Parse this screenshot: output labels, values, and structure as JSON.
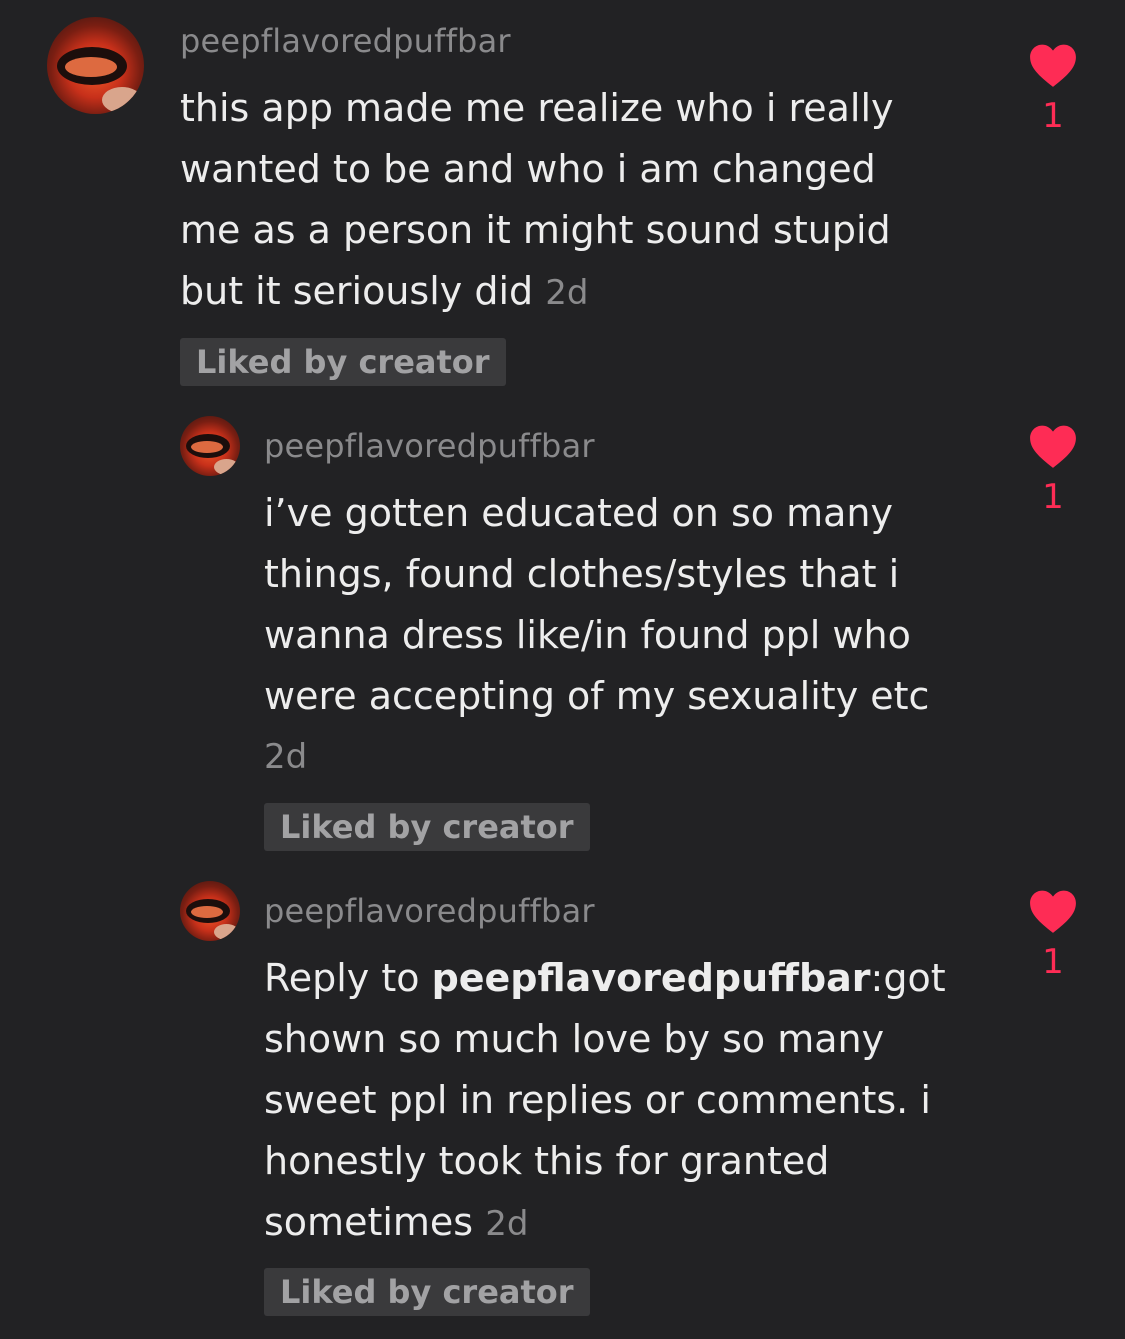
{
  "comments": [
    {
      "username": "peepflavoredpuffbar",
      "lines": [
        "this app made me realize who i really",
        "wanted to be and who i am changed",
        "me as a person it might sound stupid",
        "but it seriously did"
      ],
      "time": "2d",
      "liked_tag": "Liked by creator",
      "likes": "1"
    },
    {
      "username": "peepflavoredpuffbar",
      "lines": [
        "i’ve gotten educated on so many",
        "things, found clothes/styles that i",
        "wanna dress like/in found ppl who",
        "were accepting of my sexuality etc"
      ],
      "time": "2d",
      "liked_tag": "Liked by creator",
      "likes": "1"
    },
    {
      "username": "peepflavoredpuffbar",
      "reply_prefix": "Reply to ",
      "reply_to": "peepflavoredpuffbar",
      "reply_colon_text": ":got",
      "lines": [
        "shown so much love by so many",
        "sweet ppl in replies or comments. i",
        "honestly took this for granted",
        "sometimes"
      ],
      "time": "2d",
      "liked_tag": "Liked by creator",
      "likes": "1"
    }
  ],
  "colors": {
    "background": "#222224",
    "text": "#ededed",
    "muted": "#8a8a8c",
    "like": "#fe2c55",
    "tag_bg": "#3a3a3c"
  },
  "icons": {
    "like": "heart-icon"
  }
}
